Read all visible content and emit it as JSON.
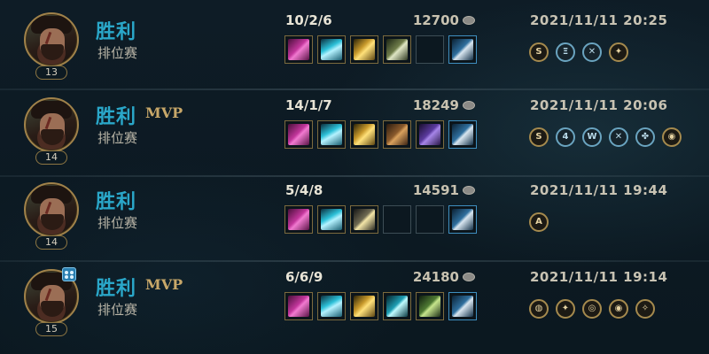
{
  "matches": [
    {
      "result": "胜利",
      "mvp": "",
      "queue": "排位赛",
      "level": "13",
      "party": false,
      "kda": "10/2/6",
      "gold": "12700",
      "datetime": "2021/11/11 20:25",
      "items": [
        "magenta-blade-item",
        "crystal-claw-item",
        "gold-sword-item",
        "green-blade-item",
        "empty",
        "blue-trinket"
      ],
      "medals": [
        {
          "icon": "S",
          "style": "gold"
        },
        {
          "icon": "Ξ",
          "style": "blue"
        },
        {
          "icon": "✕",
          "style": "blue"
        },
        {
          "icon": "✦",
          "style": "gold"
        }
      ]
    },
    {
      "result": "胜利",
      "mvp": "MVP",
      "queue": "排位赛",
      "level": "14",
      "party": false,
      "kda": "14/1/7",
      "gold": "18249",
      "datetime": "2021/11/11 20:06",
      "items": [
        "magenta-blade-item",
        "crystal-claw-item",
        "gold-sword-item",
        "hammer-item",
        "purple-cloak-item",
        "blue-trinket"
      ],
      "medals": [
        {
          "icon": "S",
          "style": "gold"
        },
        {
          "icon": "4",
          "style": "blue"
        },
        {
          "icon": "W",
          "style": "blue"
        },
        {
          "icon": "✕",
          "style": "blue"
        },
        {
          "icon": "✤",
          "style": "blue"
        },
        {
          "icon": "◉",
          "style": "gold"
        }
      ]
    },
    {
      "result": "胜利",
      "mvp": "",
      "queue": "排位赛",
      "level": "14",
      "party": false,
      "kda": "5/4/8",
      "gold": "14591",
      "datetime": "2021/11/11 19:44",
      "items": [
        "magenta-blade-item",
        "crystal-claw-item",
        "star-blade-item",
        "empty",
        "empty",
        "blue-trinket"
      ],
      "medals": [
        {
          "icon": "A",
          "style": "gold"
        }
      ]
    },
    {
      "result": "胜利",
      "mvp": "MVP",
      "queue": "排位赛",
      "level": "15",
      "party": true,
      "kda": "6/6/9",
      "gold": "24180",
      "datetime": "2021/11/11 19:14",
      "items": [
        "magenta-blade-item",
        "crystal-claw-item",
        "gold-sword-item",
        "teal-scythe-item",
        "green-gun-item",
        "blue-trinket"
      ],
      "medals": [
        {
          "icon": "◍",
          "style": "gold"
        },
        {
          "icon": "✦",
          "style": "gold"
        },
        {
          "icon": "◎",
          "style": "gold"
        },
        {
          "icon": "◉",
          "style": "gold"
        },
        {
          "icon": "✧",
          "style": "gold"
        }
      ]
    }
  ],
  "colors": {
    "victory": "#2aa7c9",
    "mvp": "#c8a869",
    "gold_border": "#a0824a",
    "trinket_border": "#3f8fc0"
  }
}
